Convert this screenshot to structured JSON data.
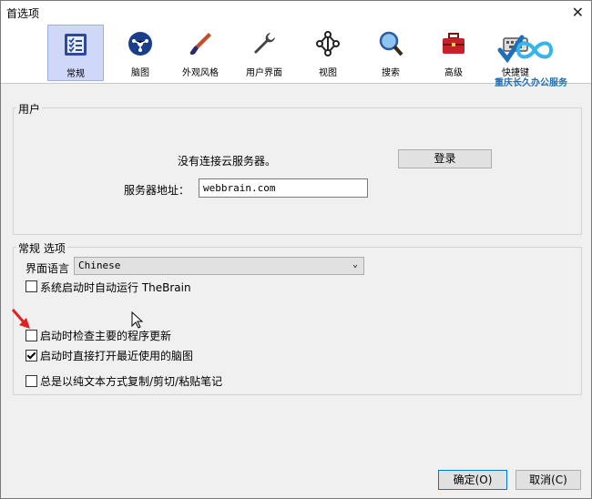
{
  "window": {
    "title": "首选项"
  },
  "toolbar": {
    "items": [
      {
        "label": "常规",
        "icon": "general-list-icon"
      },
      {
        "label": "脑图",
        "icon": "brain-icon"
      },
      {
        "label": "外观风格",
        "icon": "paintbrush-icon"
      },
      {
        "label": "用户界面",
        "icon": "wrench-icon"
      },
      {
        "label": "视图",
        "icon": "network-icon"
      },
      {
        "label": "搜索",
        "icon": "magnifier-icon"
      },
      {
        "label": "高级",
        "icon": "toolbox-icon"
      },
      {
        "label": "快捷键",
        "icon": "keyboard-icon"
      }
    ],
    "active": "常规"
  },
  "watermark": {
    "text": "重庆长久办公服务"
  },
  "user_group": {
    "title": "用户",
    "status": "没有连接云服务器。",
    "login_label": "登录",
    "server_label": "服务器地址：",
    "server_value": "webbrain.com"
  },
  "general_group": {
    "title": "常规 选项",
    "language_label": "界面语言",
    "language_value": "Chinese",
    "options": [
      {
        "label": "系统启动时自动运行 TheBrain",
        "checked": false
      },
      {
        "label": "启动时检查主要的程序更新",
        "checked": false
      },
      {
        "label": "启动时直接打开最近使用的脑图",
        "checked": true
      },
      {
        "label": "总是以纯文本方式复制/剪切/粘贴笔记",
        "checked": false
      }
    ]
  },
  "footer": {
    "ok_label": "确定(O)",
    "cancel_label": "取消(C)"
  },
  "colors": {
    "accent": "#0078d7",
    "active_tab": "#cfd8f8",
    "annotation_arrow": "#e02020"
  }
}
